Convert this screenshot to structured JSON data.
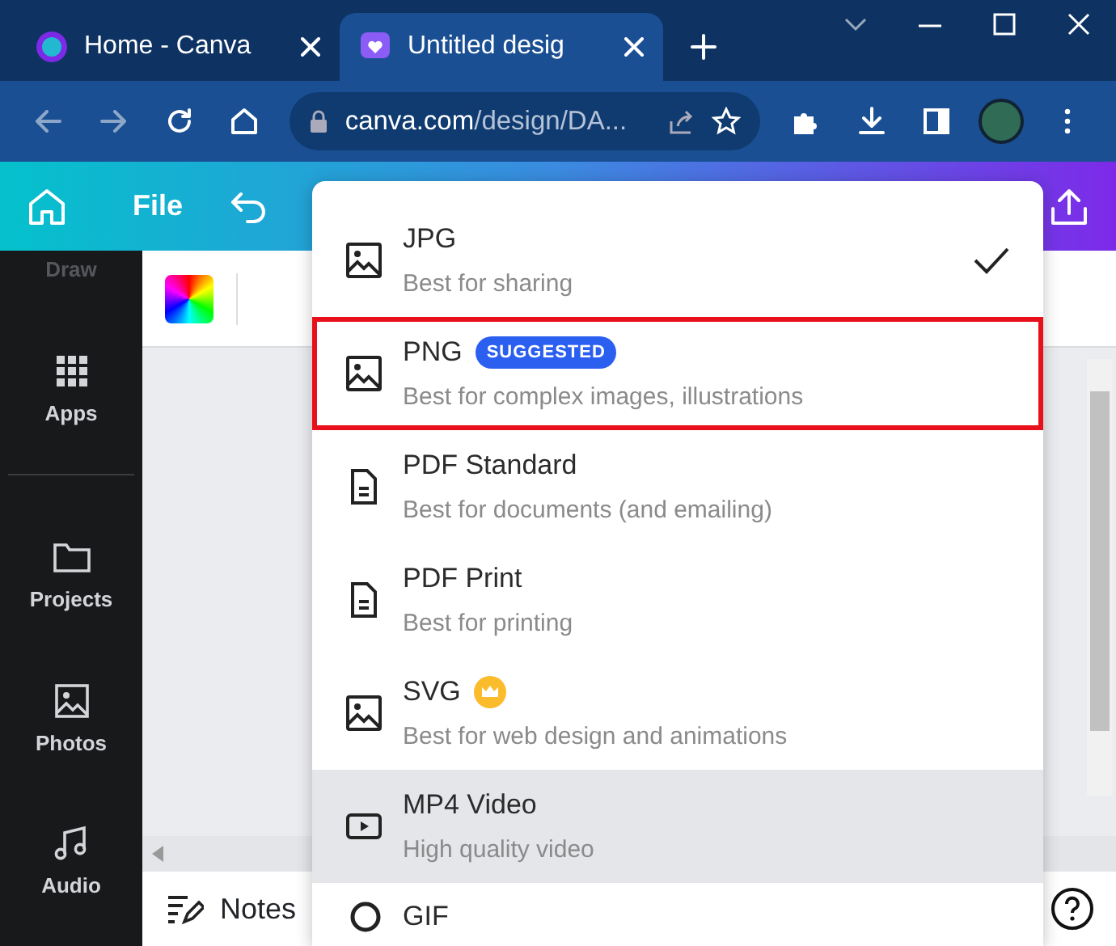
{
  "browser": {
    "tabs": [
      {
        "title": "Home - Canva",
        "kind": "home",
        "selected": false
      },
      {
        "title": "Untitled desig",
        "kind": "design",
        "selected": true
      }
    ],
    "url": {
      "host": "canva.com",
      "path": "/design/DA..."
    }
  },
  "toolbar": {
    "file_label": "File"
  },
  "sidebar": {
    "items": [
      {
        "label": "Draw",
        "kind": "draw"
      },
      {
        "label": "Apps",
        "kind": "apps"
      },
      {
        "label": "Projects",
        "kind": "projects"
      },
      {
        "label": "Photos",
        "kind": "photos"
      },
      {
        "label": "Audio",
        "kind": "audio"
      }
    ]
  },
  "notes_label": "Notes",
  "download_menu": {
    "options": [
      {
        "title": "JPG",
        "description": "Best for sharing",
        "kind": "image",
        "selected": true,
        "hovered": false,
        "highlighted": false
      },
      {
        "title": "PNG",
        "badge": "SUGGESTED",
        "description": "Best for complex images, illustrations",
        "kind": "image",
        "selected": false,
        "hovered": false,
        "highlighted": true
      },
      {
        "title": "PDF Standard",
        "description": "Best for documents (and emailing)",
        "kind": "document",
        "selected": false,
        "hovered": false,
        "highlighted": false
      },
      {
        "title": "PDF Print",
        "description": "Best for printing",
        "kind": "document",
        "selected": false,
        "hovered": false,
        "highlighted": false
      },
      {
        "title": "SVG",
        "premium": true,
        "description": "Best for web design and animations",
        "kind": "image",
        "selected": false,
        "hovered": false,
        "highlighted": false
      },
      {
        "title": "MP4 Video",
        "description": "High quality video",
        "kind": "video",
        "selected": false,
        "hovered": true,
        "highlighted": false
      },
      {
        "title": "GIF",
        "kind": "gif",
        "selected": false,
        "hovered": false,
        "highlighted": false
      }
    ]
  }
}
